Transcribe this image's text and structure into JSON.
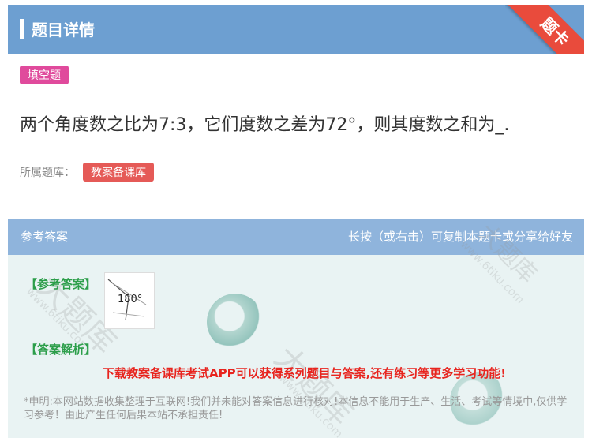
{
  "header": {
    "title": "题目详情",
    "corner_badge": "题卡"
  },
  "question": {
    "type_tag": "填空题",
    "text": "两个角度数之比为7:3，它们度数之差为72°，则其度数之和为_.",
    "source_label": "所属题库：",
    "source_tag": "教案备课库"
  },
  "answer_panel": {
    "title": "参考答案",
    "hint": "长按（或右击）可复制本题卡或分享给好友",
    "answer_label": "【参考答案】",
    "answer_value": "180°",
    "analysis_label": "【答案解析】",
    "promo": "下载教案备课库考试APP可以获得系列题目与答案,还有练习等更多学习功能!",
    "disclaimer": "*申明:本网站数据收集整理于互联网!我们并未能对答案信息进行核对!本信息不能用于生产、生活、考试等情境中,仅供学习参考！由此产生任何后果本站不承担责任!"
  },
  "watermarks": [
    "www.6tiku.com",
    "大题库"
  ],
  "colors": {
    "header": "#6d9fd1",
    "answer_head": "#8fb4dc",
    "accent_red": "#e8241e",
    "tag_pink": "#e04a9c"
  }
}
